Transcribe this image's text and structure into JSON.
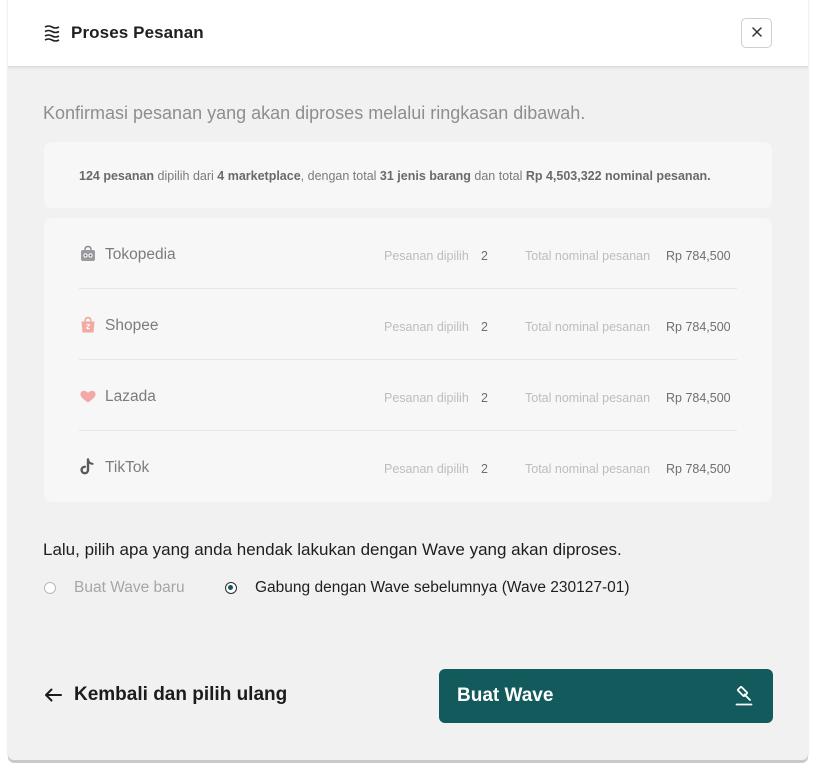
{
  "modal": {
    "title": "Proses Pesanan",
    "title_icon": "layers-icon",
    "close_icon": "close-icon"
  },
  "intro": "Konfirmasi pesanan yang akan diproses melalui ringkasan dibawah.",
  "summary": {
    "orders": "124 pesanan",
    "text1": " dipilih dari ",
    "marketplaces": "4 marketplace",
    "text2": ", dengan total ",
    "item_types": "31 jenis barang",
    "text3": " dan total ",
    "amount": "Rp 4,503,322 nominal pesanan."
  },
  "marketplaces": [
    {
      "name": "Tokopedia",
      "icon": "tokopedia-icon",
      "count_label": "Pesanan dipilih",
      "count": "2",
      "total_label": "Total nominal pesanan",
      "total": "Rp 784,500"
    },
    {
      "name": "Shopee",
      "icon": "shopee-icon",
      "count_label": "Pesanan dipilih",
      "count": "2",
      "total_label": "Total nominal pesanan",
      "total": "Rp 784,500"
    },
    {
      "name": "Lazada",
      "icon": "lazada-icon",
      "count_label": "Pesanan dipilih",
      "count": "2",
      "total_label": "Total nominal pesanan",
      "total": "Rp 784,500"
    },
    {
      "name": "TikTok",
      "icon": "tiktok-icon",
      "count_label": "Pesanan dipilih",
      "count": "2",
      "total_label": "Total nominal pesanan",
      "total": "Rp 784,500"
    }
  ],
  "question": "Lalu, pilih apa yang anda hendak lakukan dengan Wave yang akan diproses.",
  "options": [
    {
      "label": "Buat Wave baru",
      "selected": false
    },
    {
      "label": "Gabung dengan Wave sebelumnya (Wave 230127-01)",
      "selected": true
    }
  ],
  "actions": {
    "back_label": "Kembali dan pilih ulang",
    "primary_label": "Buat Wave",
    "primary_icon": "gavel-icon"
  },
  "colors": {
    "primary": "#135a5d",
    "background": "#f1f1f2",
    "shopee": "#f4a9a0",
    "lazada": "#f2a9a9"
  }
}
